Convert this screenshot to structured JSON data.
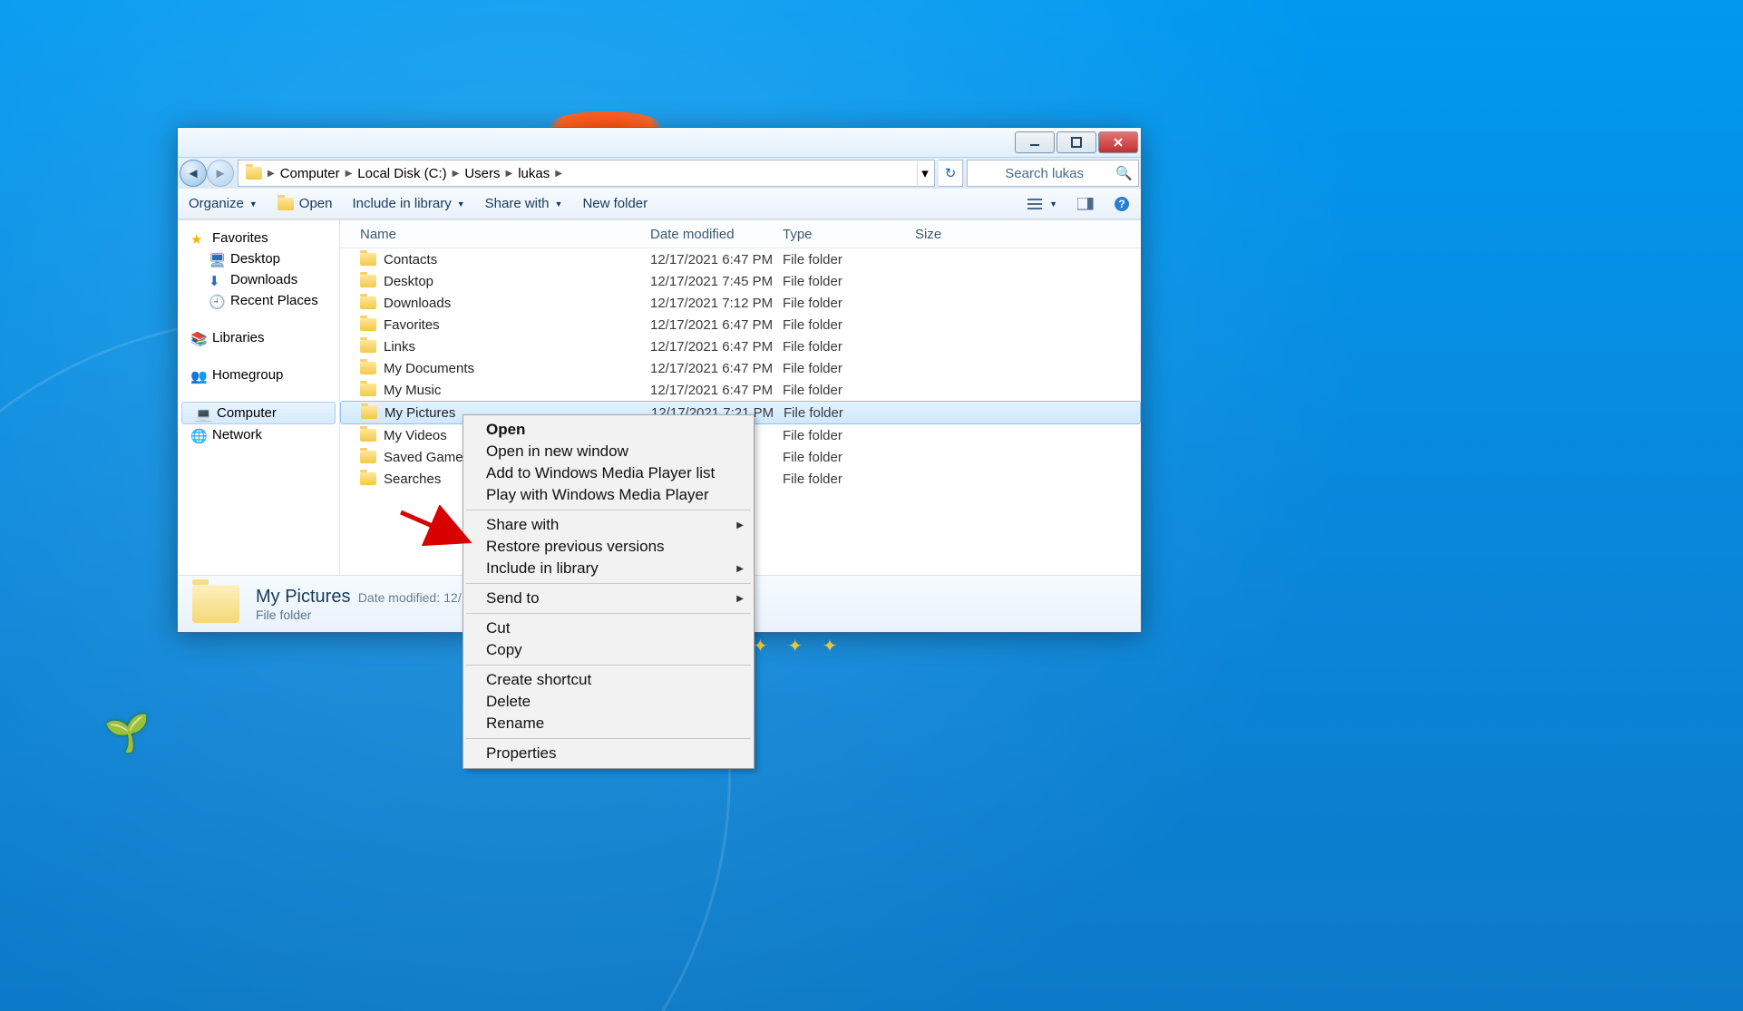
{
  "breadcrumb": [
    "Computer",
    "Local Disk (C:)",
    "Users",
    "lukas"
  ],
  "search": {
    "placeholder": "Search lukas"
  },
  "toolbar": {
    "organize": "Organize",
    "open": "Open",
    "include": "Include in library",
    "share": "Share with",
    "newfolder": "New folder"
  },
  "nav": {
    "favorites": {
      "label": "Favorites",
      "children": [
        "Desktop",
        "Downloads",
        "Recent Places"
      ]
    },
    "libraries": {
      "label": "Libraries"
    },
    "homegroup": {
      "label": "Homegroup"
    },
    "computer": {
      "label": "Computer"
    },
    "network": {
      "label": "Network"
    }
  },
  "columns": {
    "name": "Name",
    "date": "Date modified",
    "type": "Type",
    "size": "Size"
  },
  "files": [
    {
      "name": "Contacts",
      "date": "12/17/2021 6:47 PM",
      "type": "File folder",
      "icon": "folder"
    },
    {
      "name": "Desktop",
      "date": "12/17/2021 7:45 PM",
      "type": "File folder",
      "icon": "folder"
    },
    {
      "name": "Downloads",
      "date": "12/17/2021 7:12 PM",
      "type": "File folder",
      "icon": "folder"
    },
    {
      "name": "Favorites",
      "date": "12/17/2021 6:47 PM",
      "type": "File folder",
      "icon": "folder"
    },
    {
      "name": "Links",
      "date": "12/17/2021 6:47 PM",
      "type": "File folder",
      "icon": "folder"
    },
    {
      "name": "My Documents",
      "date": "12/17/2021 6:47 PM",
      "type": "File folder",
      "icon": "folder"
    },
    {
      "name": "My Music",
      "date": "12/17/2021 6:47 PM",
      "type": "File folder",
      "icon": "folder"
    },
    {
      "name": "My Pictures",
      "date": "12/17/2021 7:21 PM",
      "type": "File folder",
      "icon": "folder",
      "selected": true
    },
    {
      "name": "My Videos",
      "date": "PM",
      "type": "File folder",
      "icon": "folder"
    },
    {
      "name": "Saved Games",
      "date": "PM",
      "type": "File folder",
      "icon": "folder"
    },
    {
      "name": "Searches",
      "date": "PM",
      "type": "File folder",
      "icon": "folder"
    }
  ],
  "details": {
    "title": "My Pictures",
    "type": "File folder",
    "meta_label": "Date modified:",
    "meta_value": "12/"
  },
  "context_menu": [
    {
      "label": "Open",
      "bold": true
    },
    {
      "label": "Open in new window"
    },
    {
      "label": "Add to Windows Media Player list"
    },
    {
      "label": "Play with Windows Media Player"
    },
    {
      "sep": true
    },
    {
      "label": "Share with",
      "submenu": true
    },
    {
      "label": "Restore previous versions"
    },
    {
      "label": "Include in library",
      "submenu": true
    },
    {
      "sep": true
    },
    {
      "label": "Send to",
      "submenu": true
    },
    {
      "sep": true
    },
    {
      "label": "Cut"
    },
    {
      "label": "Copy"
    },
    {
      "sep": true
    },
    {
      "label": "Create shortcut"
    },
    {
      "label": "Delete"
    },
    {
      "label": "Rename"
    },
    {
      "sep": true
    },
    {
      "label": "Properties"
    }
  ]
}
